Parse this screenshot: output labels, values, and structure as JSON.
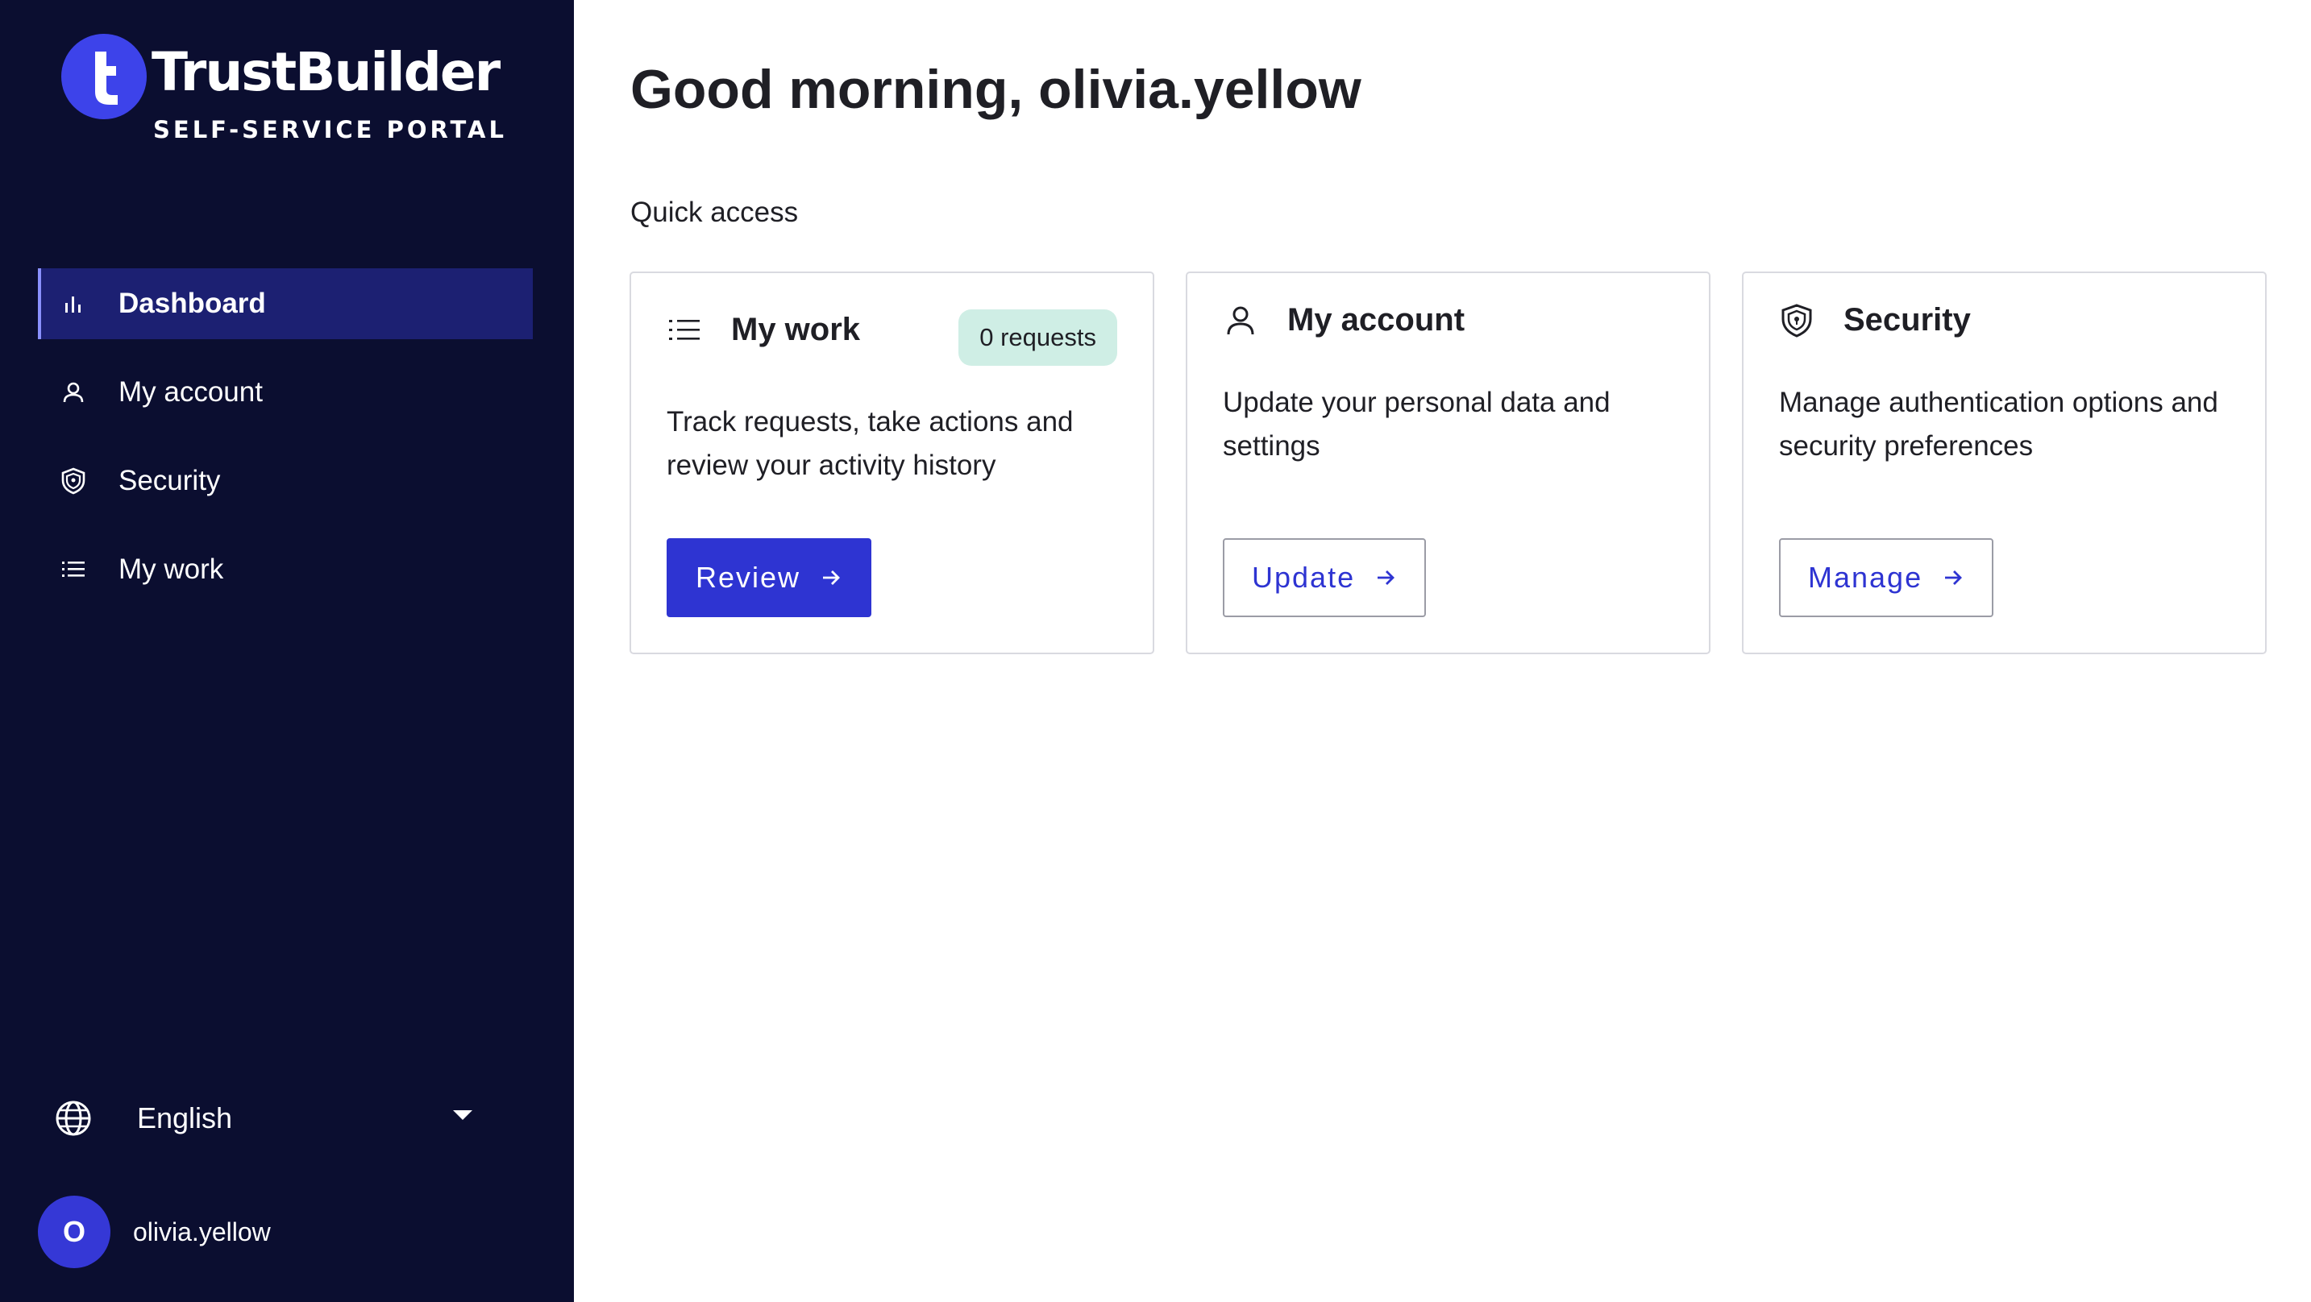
{
  "brand": {
    "name": "TrustBuilder",
    "subtitle": "SELF-SERVICE PORTAL",
    "accent": "#3d43ea",
    "sidebar_bg": "#0b0e30"
  },
  "sidebar": {
    "items": [
      {
        "label": "Dashboard",
        "icon": "bar-chart-icon",
        "active": true
      },
      {
        "label": "My account",
        "icon": "user-icon",
        "active": false
      },
      {
        "label": "Security",
        "icon": "shield-icon",
        "active": false
      },
      {
        "label": "My work",
        "icon": "list-icon",
        "active": false
      }
    ],
    "language": {
      "selected": "English",
      "icon": "globe-icon"
    },
    "user": {
      "initial": "O",
      "name": "olivia.yellow"
    }
  },
  "main": {
    "greeting": "Good morning, olivia.yellow",
    "section_title": "Quick access",
    "cards": [
      {
        "title": "My work",
        "icon": "list-icon",
        "badge": "0 requests",
        "description": "Track requests, take actions and review your activity history",
        "button": "Review"
      },
      {
        "title": "My account",
        "icon": "user-icon",
        "description": "Update your personal data and settings",
        "button": "Update"
      },
      {
        "title": "Security",
        "icon": "shield-icon",
        "description": "Manage authentication options and security preferences",
        "button": "Manage"
      }
    ]
  }
}
